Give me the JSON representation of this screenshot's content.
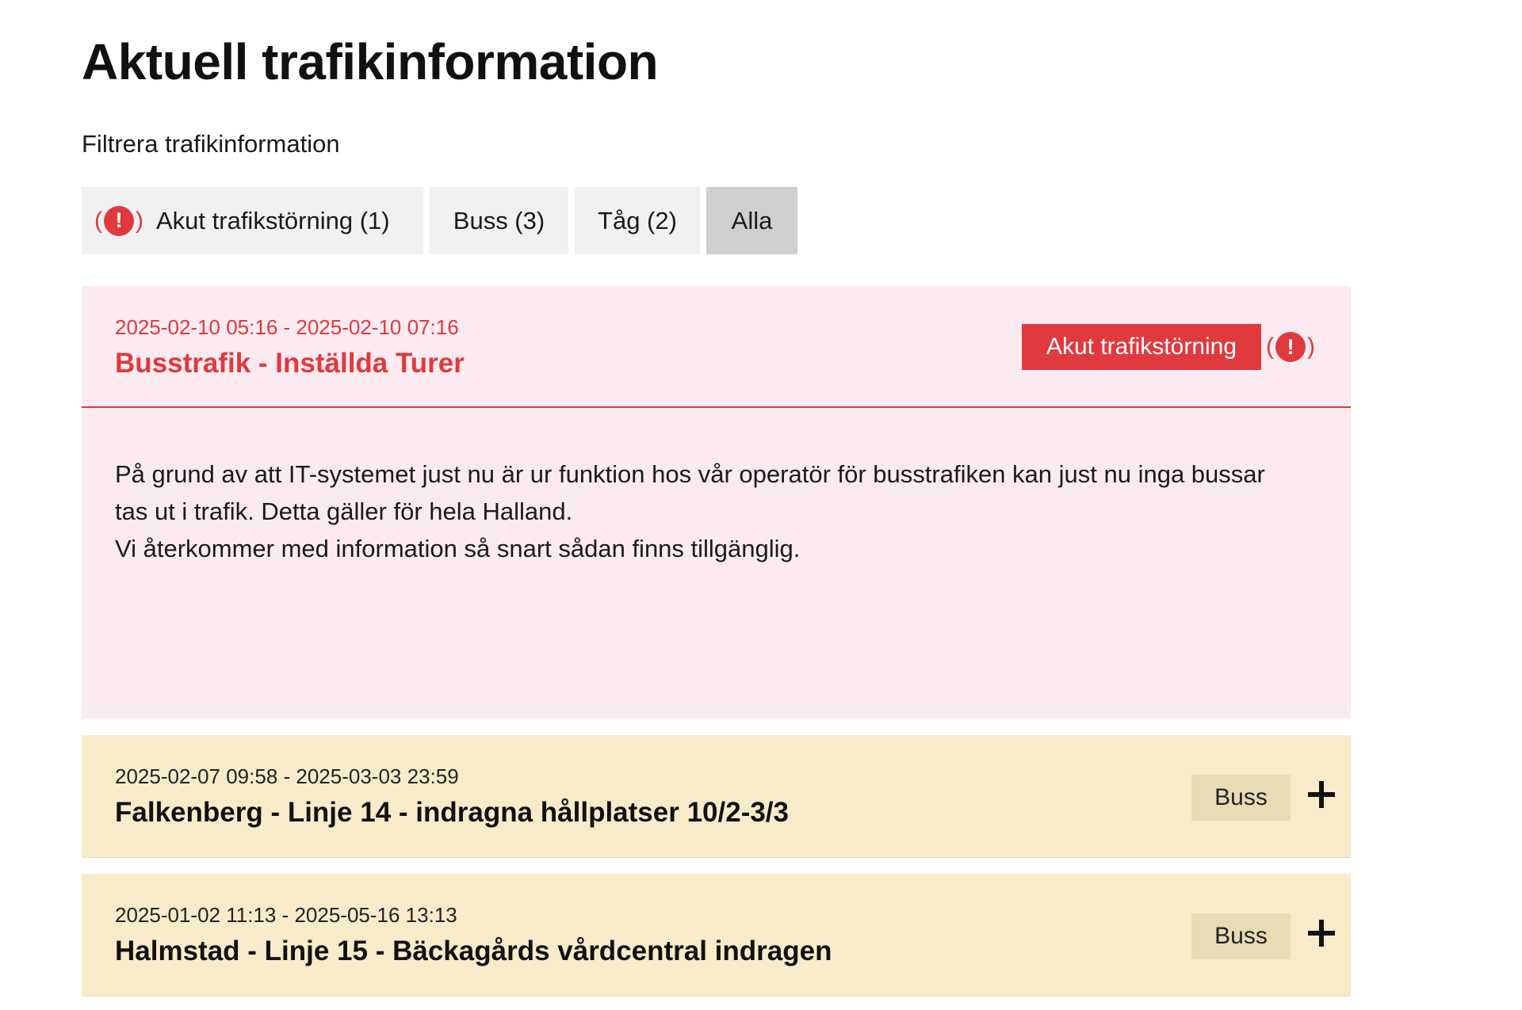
{
  "page": {
    "title": "Aktuell trafikinformation"
  },
  "filter": {
    "label": "Filtrera trafikinformation",
    "buttons": [
      {
        "label": "Akut trafikstörning (1)",
        "icon": "alert-icon",
        "active": false
      },
      {
        "label": "Buss (3)",
        "active": false
      },
      {
        "label": "Tåg (2)",
        "active": false
      },
      {
        "label": "Alla",
        "active": true
      }
    ]
  },
  "alert_icon": {
    "open": "(",
    "mark": "!",
    "close": ")"
  },
  "urgent_card": {
    "date": "2025-02-10 05:16 - 2025-02-10 07:16",
    "title": "Busstrafik - Inställda Turer",
    "tag": "Akut trafikstörning",
    "body": [
      "På grund av att IT-systemet just nu är ur funktion hos vår operatör för busstrafiken kan just nu inga bussar tas ut i trafik. Detta gäller för hela Halland.",
      "Vi återkommer med information så snart sådan finns tillgänglig."
    ]
  },
  "bus_cards": [
    {
      "date": "2025-02-07 09:58 - 2025-03-03 23:59",
      "title": "Falkenberg - Linje 14 - indragna hållplatser 10/2-3/3",
      "tag": "Buss"
    },
    {
      "date": "2025-01-02 11:13 - 2025-05-16 13:13",
      "title": "Halmstad - Linje 15 - Bäckagårds vårdcentral indragen",
      "tag": "Buss"
    }
  ],
  "colors": {
    "urgent_red": "#e0393e",
    "urgent_bg": "#fbebf0",
    "bus_bg": "#f7ebca",
    "bus_tag_bg": "#e8dcb5",
    "filter_bg": "#f1f1f1",
    "filter_active_bg": "#cfcfcf"
  }
}
